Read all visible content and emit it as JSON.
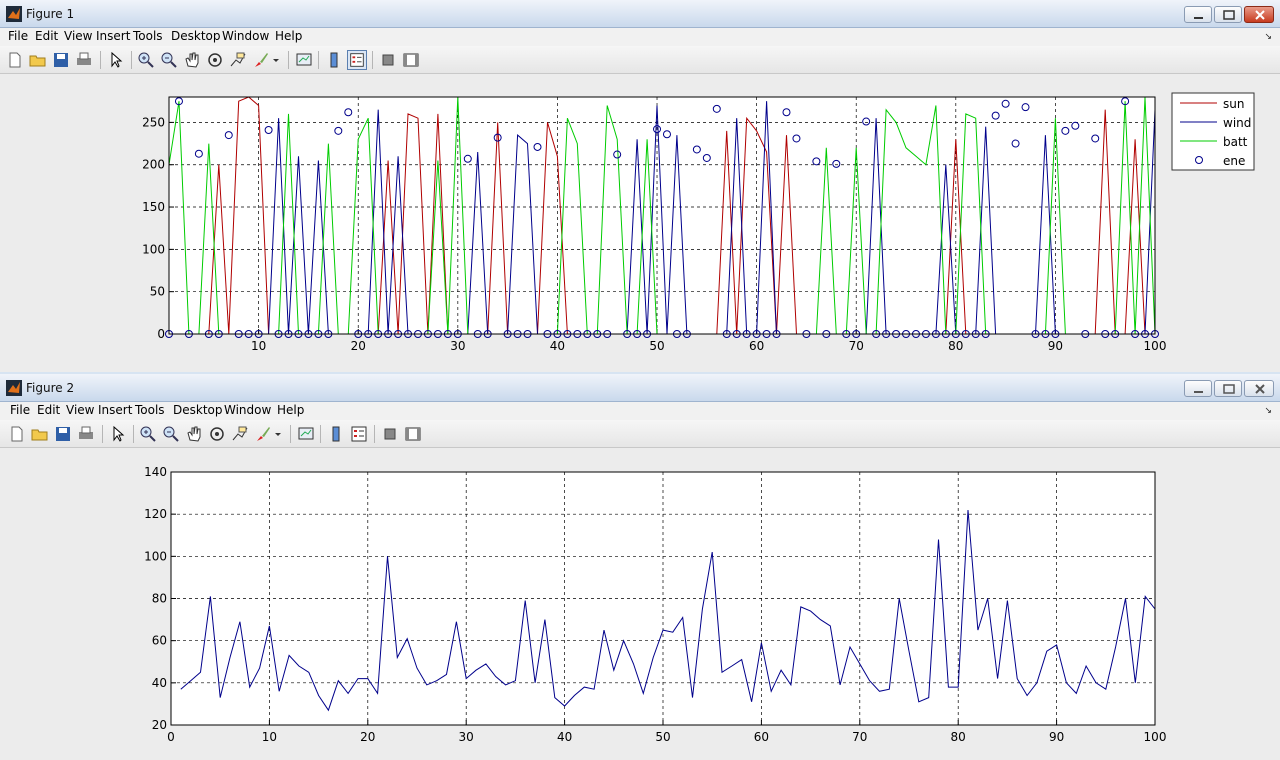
{
  "windows": [
    {
      "title": "Figure 1",
      "menu": [
        "File",
        "Edit",
        "View",
        "Insert",
        "Tools",
        "Desktop",
        "Window",
        "Help"
      ]
    },
    {
      "title": "Figure 2",
      "menu": [
        "File",
        "Edit",
        "View",
        "Insert",
        "Tools",
        "Desktop",
        "Window",
        "Help"
      ]
    }
  ],
  "toolbar_icons": [
    "new-figure-icon",
    "open-file-icon",
    "save-icon",
    "print-icon",
    "select-arrow-icon",
    "zoom-in-icon",
    "zoom-out-icon",
    "pan-hand-icon",
    "rotate-3d-icon",
    "data-cursor-icon",
    "brush-icon",
    "brush-dropdown-icon",
    "link-plot-icon",
    "colorbar-icon",
    "legend-icon",
    "hide-plot-tools-icon",
    "show-plot-tools-icon"
  ],
  "colors": {
    "sun": "#b00000",
    "wind": "#00008b",
    "batt": "#00cc00",
    "ene": "#00008b",
    "series2": "#00008b"
  },
  "chart_data": [
    {
      "type": "line",
      "title": "",
      "xlabel": "",
      "ylabel": "",
      "xlim": [
        1,
        100
      ],
      "ylim": [
        0,
        280
      ],
      "xticks": [
        10,
        20,
        30,
        40,
        50,
        60,
        70,
        80,
        90,
        100
      ],
      "yticks": [
        0,
        50,
        100,
        150,
        200,
        250
      ],
      "tick_labels_x": [
        "10",
        "20",
        "30",
        "40",
        "50",
        "60",
        "70",
        "80",
        "90",
        "100"
      ],
      "tick_labels_y": [
        "0",
        "50",
        "100",
        "150",
        "200",
        "250"
      ],
      "grid": true,
      "legend_position": "outside-right",
      "series": [
        {
          "name": "sun",
          "values": [
            0,
            0,
            0,
            0,
            0,
            200,
            0,
            275,
            280,
            270,
            0,
            0,
            0,
            0,
            0,
            0,
            0,
            0,
            0,
            0,
            0,
            0,
            205,
            0,
            260,
            255,
            0,
            260,
            0,
            0,
            0,
            0,
            0,
            250,
            0,
            0,
            0,
            0,
            250,
            210,
            0,
            0,
            0,
            0,
            0,
            0,
            0,
            0,
            0,
            0,
            0,
            0,
            0,
            0,
            0,
            0,
            240,
            0,
            255,
            240,
            215,
            0,
            235,
            0,
            0,
            0,
            0,
            0,
            0,
            0,
            0,
            0,
            0,
            0,
            0,
            0,
            0,
            0,
            0,
            230,
            0,
            0,
            0,
            0,
            0,
            0,
            0,
            0,
            0,
            0,
            0,
            0,
            0,
            0,
            265,
            0,
            0,
            230,
            0,
            0
          ]
        },
        {
          "name": "wind",
          "values": [
            0,
            0,
            0,
            0,
            0,
            0,
            0,
            0,
            0,
            0,
            0,
            255,
            0,
            210,
            0,
            205,
            0,
            0,
            0,
            0,
            0,
            265,
            0,
            210,
            0,
            0,
            0,
            0,
            0,
            0,
            0,
            215,
            0,
            0,
            0,
            235,
            225,
            0,
            0,
            0,
            0,
            0,
            0,
            0,
            0,
            0,
            0,
            230,
            0,
            270,
            0,
            235,
            0,
            0,
            0,
            0,
            0,
            255,
            0,
            0,
            275,
            0,
            0,
            0,
            0,
            0,
            0,
            0,
            0,
            0,
            0,
            255,
            0,
            0,
            0,
            0,
            0,
            0,
            200,
            0,
            0,
            0,
            245,
            0,
            0,
            0,
            0,
            0,
            235,
            0,
            0,
            0,
            0,
            0,
            0,
            0,
            0,
            0,
            0,
            265
          ]
        },
        {
          "name": "batt",
          "values": [
            200,
            275,
            0,
            0,
            225,
            0,
            0,
            0,
            0,
            0,
            0,
            0,
            260,
            0,
            0,
            0,
            225,
            0,
            0,
            230,
            255,
            0,
            0,
            0,
            0,
            0,
            0,
            205,
            0,
            280,
            0,
            0,
            0,
            0,
            0,
            0,
            0,
            0,
            0,
            0,
            255,
            225,
            0,
            0,
            270,
            230,
            0,
            0,
            230,
            0,
            0,
            0,
            0,
            0,
            0,
            0,
            0,
            0,
            0,
            0,
            0,
            0,
            0,
            0,
            0,
            0,
            220,
            0,
            0,
            220,
            0,
            0,
            265,
            250,
            220,
            210,
            200,
            270,
            0,
            0,
            260,
            255,
            0,
            0,
            0,
            0,
            0,
            0,
            0,
            255,
            0,
            0,
            0,
            0,
            0,
            0,
            275,
            0,
            280,
            0
          ]
        }
      ],
      "markers": {
        "name": "ene",
        "points": [
          [
            1,
            0
          ],
          [
            2,
            275
          ],
          [
            3,
            0
          ],
          [
            4,
            213
          ],
          [
            5,
            0
          ],
          [
            6,
            0
          ],
          [
            7,
            235
          ],
          [
            8,
            0
          ],
          [
            9,
            0
          ],
          [
            10,
            0
          ],
          [
            11,
            241
          ],
          [
            12,
            0
          ],
          [
            13,
            0
          ],
          [
            14,
            0
          ],
          [
            15,
            0
          ],
          [
            16,
            0
          ],
          [
            17,
            0
          ],
          [
            18,
            240
          ],
          [
            19,
            262
          ],
          [
            20,
            0
          ],
          [
            21,
            0
          ],
          [
            22,
            0
          ],
          [
            23,
            0
          ],
          [
            24,
            0
          ],
          [
            25,
            0
          ],
          [
            26,
            0
          ],
          [
            27,
            0
          ],
          [
            28,
            0
          ],
          [
            29,
            0
          ],
          [
            30,
            0
          ],
          [
            31,
            207
          ],
          [
            32,
            0
          ],
          [
            33,
            0
          ],
          [
            34,
            232
          ],
          [
            35,
            0
          ],
          [
            36,
            0
          ],
          [
            37,
            0
          ],
          [
            38,
            221
          ],
          [
            39,
            0
          ],
          [
            40,
            0
          ],
          [
            41,
            0
          ],
          [
            42,
            0
          ],
          [
            43,
            0
          ],
          [
            44,
            0
          ],
          [
            45,
            0
          ],
          [
            46,
            212
          ],
          [
            47,
            0
          ],
          [
            48,
            0
          ],
          [
            49,
            0
          ],
          [
            50,
            242
          ],
          [
            51,
            236
          ],
          [
            52,
            0
          ],
          [
            53,
            0
          ],
          [
            54,
            218
          ],
          [
            55,
            208
          ],
          [
            56,
            266
          ],
          [
            57,
            0
          ],
          [
            58,
            0
          ],
          [
            59,
            0
          ],
          [
            60,
            0
          ],
          [
            61,
            0
          ],
          [
            62,
            0
          ],
          [
            63,
            262
          ],
          [
            64,
            231
          ],
          [
            65,
            0
          ],
          [
            66,
            204
          ],
          [
            67,
            0
          ],
          [
            68,
            201
          ],
          [
            69,
            0
          ],
          [
            70,
            0
          ],
          [
            71,
            251
          ],
          [
            72,
            0
          ],
          [
            73,
            0
          ],
          [
            74,
            0
          ],
          [
            75,
            0
          ],
          [
            76,
            0
          ],
          [
            77,
            0
          ],
          [
            78,
            0
          ],
          [
            79,
            0
          ],
          [
            80,
            0
          ],
          [
            81,
            0
          ],
          [
            82,
            0
          ],
          [
            83,
            0
          ],
          [
            84,
            258
          ],
          [
            85,
            272
          ],
          [
            86,
            225
          ],
          [
            87,
            268
          ],
          [
            88,
            0
          ],
          [
            89,
            0
          ],
          [
            90,
            0
          ],
          [
            91,
            240
          ],
          [
            92,
            246
          ],
          [
            93,
            0
          ],
          [
            94,
            231
          ],
          [
            95,
            0
          ],
          [
            96,
            0
          ],
          [
            97,
            275
          ],
          [
            98,
            0
          ],
          [
            99,
            0
          ],
          [
            100,
            0
          ]
        ]
      }
    },
    {
      "type": "line",
      "title": "",
      "xlabel": "",
      "ylabel": "",
      "xlim": [
        0,
        100
      ],
      "ylim": [
        20,
        140
      ],
      "xticks": [
        0,
        10,
        20,
        30,
        40,
        50,
        60,
        70,
        80,
        90,
        100
      ],
      "yticks": [
        20,
        40,
        60,
        80,
        100,
        120,
        140
      ],
      "tick_labels_x": [
        "0",
        "10",
        "20",
        "30",
        "40",
        "50",
        "60",
        "70",
        "80",
        "90",
        "100"
      ],
      "tick_labels_y": [
        "20",
        "40",
        "60",
        "80",
        "100",
        "120",
        "140"
      ],
      "grid": true,
      "series": [
        {
          "values": [
            37,
            41,
            45,
            81,
            33,
            52,
            69,
            38,
            47,
            67,
            36,
            53,
            48,
            45,
            34,
            27,
            41,
            35,
            42,
            42,
            35,
            100,
            52,
            61,
            47,
            39,
            41,
            44,
            69,
            42,
            46,
            49,
            43,
            39,
            41,
            79,
            40,
            70,
            33,
            29,
            34,
            38,
            37,
            65,
            46,
            60,
            49,
            35,
            52,
            65,
            64,
            71,
            33,
            75,
            102,
            45,
            48,
            51,
            31,
            59,
            36,
            46,
            39,
            76,
            74,
            70,
            67,
            39,
            57,
            49,
            41,
            36,
            37,
            80,
            55,
            31,
            33,
            108,
            38,
            38,
            122,
            65,
            80,
            42,
            79,
            42,
            34,
            40,
            55,
            58,
            40,
            35,
            48,
            40,
            37,
            57,
            80,
            40,
            81,
            75
          ]
        }
      ]
    }
  ]
}
